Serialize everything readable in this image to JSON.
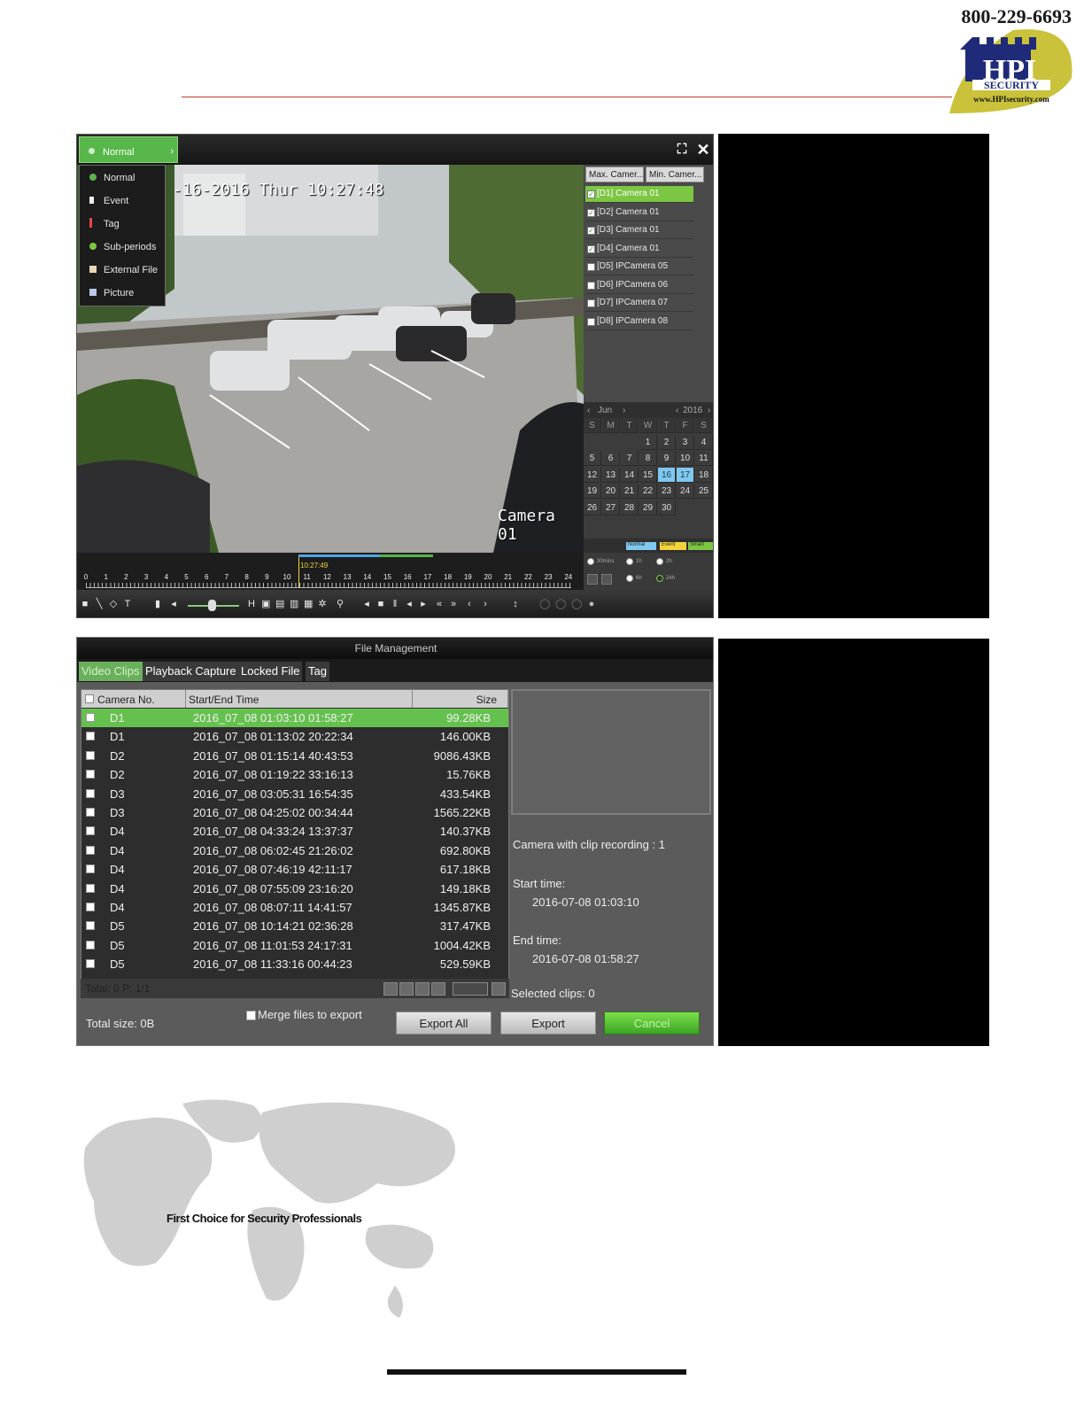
{
  "header": {
    "phone": "800-229-6693",
    "logo_text": "HPI",
    "logo_sub": "SECURITY",
    "logo_url_text": "www.HPIsecurity.com"
  },
  "playback": {
    "mode_button": "Normal",
    "mode_menu": [
      {
        "label": "Normal",
        "icon": "green-dot-icon"
      },
      {
        "label": "Event",
        "icon": "white-bar-icon"
      },
      {
        "label": "Tag",
        "icon": "red-tag-icon"
      },
      {
        "label": "Sub-periods",
        "icon": "green-pie-icon"
      },
      {
        "label": "External File",
        "icon": "file-icon"
      },
      {
        "label": "Picture",
        "icon": "picture-icon"
      }
    ],
    "osd_datetime": "-16-2016 Thur 10:27:48",
    "osd_camera": "Camera 01",
    "cam_headers": [
      "Max. Camer...",
      "Min. Camer..."
    ],
    "cameras": [
      {
        "label": "[D1] Camera 01",
        "checked": true,
        "selected": true
      },
      {
        "label": "[D2] Camera 01",
        "checked": true,
        "selected": false
      },
      {
        "label": "[D3] Camera 01",
        "checked": true,
        "selected": false
      },
      {
        "label": "[D4] Camera 01",
        "checked": true,
        "selected": false
      },
      {
        "label": "[D5] IPCamera 05",
        "checked": false,
        "selected": false
      },
      {
        "label": "[D6] IPCamera 06",
        "checked": false,
        "selected": false
      },
      {
        "label": "[D7] IPCamera 07",
        "checked": false,
        "selected": false
      },
      {
        "label": "[D8] IPCamera 08",
        "checked": false,
        "selected": false
      }
    ],
    "calendar": {
      "month": "Jun",
      "year": "2016",
      "dow": [
        "S",
        "M",
        "T",
        "W",
        "T",
        "F",
        "S"
      ],
      "first_weekday": 3,
      "days": 30,
      "highlighted": [
        16,
        17
      ]
    },
    "legend": [
      "Normal",
      "Event",
      "Smart"
    ],
    "timeline": {
      "cursor_time": "10:27:49",
      "hours": [
        "0",
        "1",
        "2",
        "3",
        "4",
        "5",
        "6",
        "7",
        "8",
        "9",
        "10",
        "11",
        "12",
        "13",
        "14",
        "15",
        "16",
        "17",
        "18",
        "19",
        "20",
        "21",
        "22",
        "23",
        "24"
      ]
    },
    "timeline_options": [
      "30mins",
      "1h",
      "2h",
      "6h",
      "24h"
    ]
  },
  "file_management": {
    "title": "File Management",
    "tabs": [
      "Video Clips",
      "Playback Capture",
      "Locked File",
      "Tag"
    ],
    "columns": [
      "Camera No.",
      "Start/End Time",
      "Size"
    ],
    "rows": [
      {
        "cam": "D1",
        "time": "2016_07_08 01:03:10 01:58:27",
        "size": "99.28KB"
      },
      {
        "cam": "D1",
        "time": "2016_07_08 01:13:02 20:22:34",
        "size": "146.00KB"
      },
      {
        "cam": "D2",
        "time": "2016_07_08 01:15:14 40:43:53",
        "size": "9086.43KB"
      },
      {
        "cam": "D2",
        "time": "2016_07_08 01:19:22 33:16:13",
        "size": "15.76KB"
      },
      {
        "cam": "D3",
        "time": "2016_07_08 03:05:31 16:54:35",
        "size": "433.54KB"
      },
      {
        "cam": "D3",
        "time": "2016_07_08 04:25:02 00:34:44",
        "size": "1565.22KB"
      },
      {
        "cam": "D4",
        "time": "2016_07_08 04:33:24 13:37:37",
        "size": "140.37KB"
      },
      {
        "cam": "D4",
        "time": "2016_07_08 06:02:45 21:26:02",
        "size": "692.80KB"
      },
      {
        "cam": "D4",
        "time": "2016_07_08 07:46:19 42:11:17",
        "size": "617.18KB"
      },
      {
        "cam": "D4",
        "time": "2016_07_08 07:55:09 23:16:20",
        "size": "149.18KB"
      },
      {
        "cam": "D4",
        "time": "2016_07_08 08:07:11 14:41:57",
        "size": "1345.87KB"
      },
      {
        "cam": "D5",
        "time": "2016_07_08 10:14:21 02:36:28",
        "size": "317.47KB"
      },
      {
        "cam": "D5",
        "time": "2016_07_08 11:01:53 24:17:31",
        "size": "1004.42KB"
      },
      {
        "cam": "D5",
        "time": "2016_07_08 11:33:16 00:44:23",
        "size": "529.59KB"
      }
    ],
    "pager_label": "Total: 0 P: 1/1",
    "camera_clip_recording": "Camera with clip recording : 1",
    "start_time_label": "Start time:",
    "start_time": "2016-07-08 01:03:10",
    "end_time_label": "End time:",
    "end_time": "2016-07-08 01:58:27",
    "selected_clips": "Selected clips: 0",
    "total_size": "Total size: 0B",
    "merge_label": "Merge files to export",
    "buttons": {
      "export_all": "Export All",
      "export": "Export",
      "cancel": "Cancel"
    }
  },
  "footer": {
    "tagline": "First Choice for Security Professionals"
  },
  "colors": {
    "accent_green": "#58b74a",
    "selected_row": "#65c14e",
    "calendar_highlight": "#7fc8f0",
    "header_rule": "#c0392b"
  }
}
